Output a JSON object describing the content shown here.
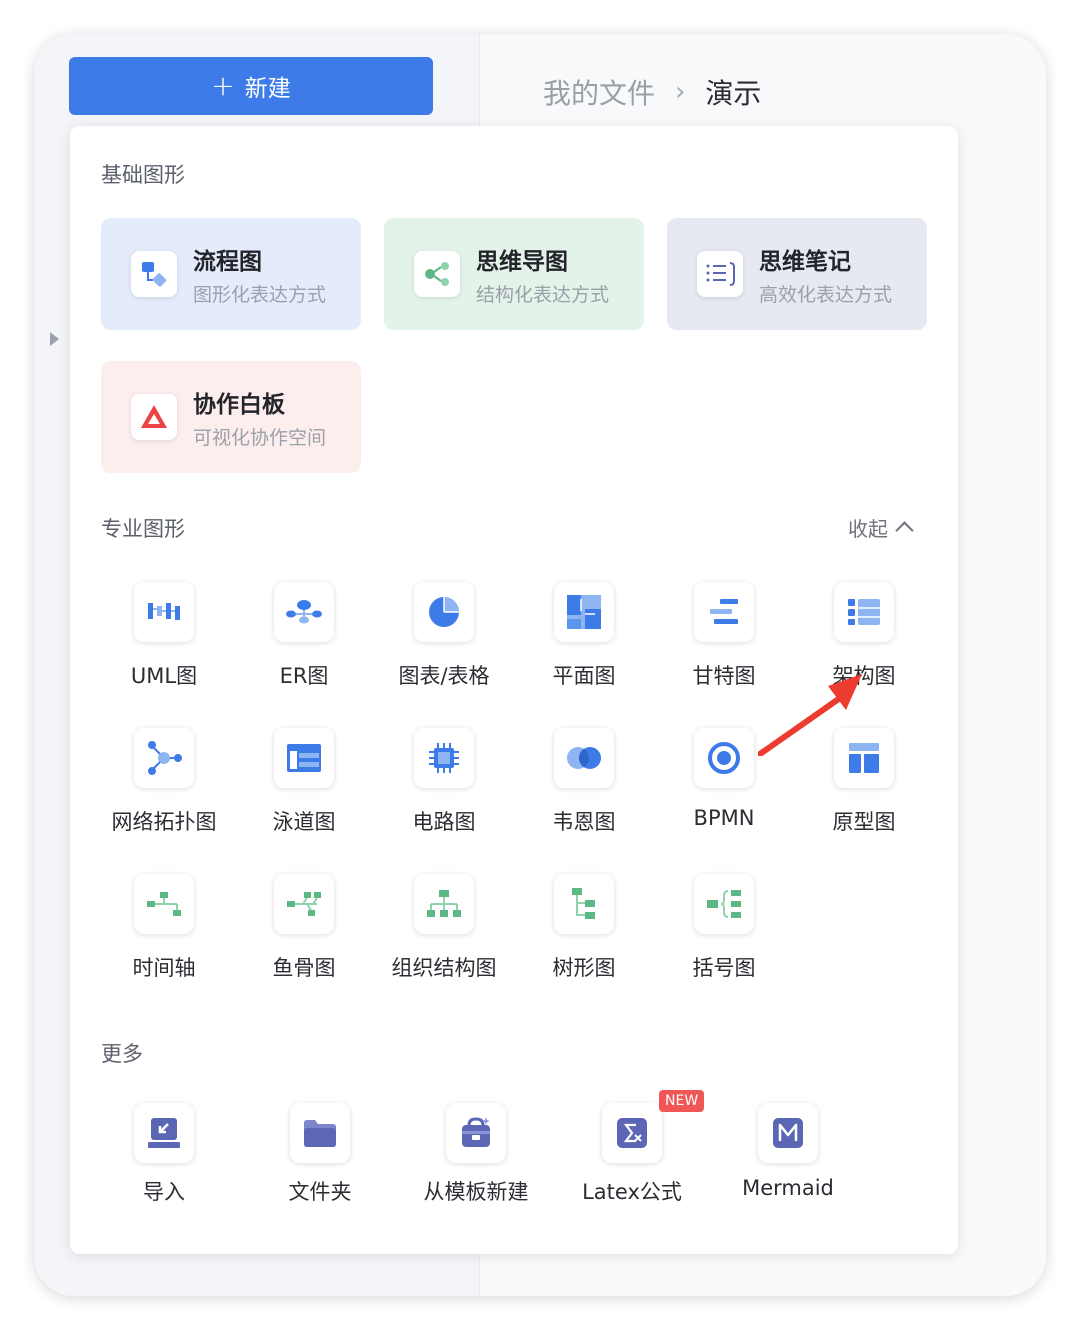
{
  "new_button": {
    "plus": "+",
    "label": "新建"
  },
  "breadcrumb": {
    "parent": "我的文件",
    "separator": "›",
    "current": "演示"
  },
  "basic": {
    "title": "基础图形",
    "cards": [
      {
        "title": "流程图",
        "subtitle": "图形化表达方式",
        "icon": "flowchart-icon",
        "bg": "#e4ecfc"
      },
      {
        "title": "思维导图",
        "subtitle": "结构化表达方式",
        "icon": "mindmap-icon",
        "bg": "#e3f3ea"
      },
      {
        "title": "思维笔记",
        "subtitle": "高效化表达方式",
        "icon": "notes-icon",
        "bg": "#e6e8f2"
      },
      {
        "title": "协作白板",
        "subtitle": "可视化协作空间",
        "icon": "whiteboard-icon",
        "bg": "#fdeeee"
      }
    ]
  },
  "pro": {
    "title": "专业图形",
    "collapse_label": "收起",
    "items": [
      {
        "label": "UML图",
        "icon": "uml-icon"
      },
      {
        "label": "ER图",
        "icon": "er-icon"
      },
      {
        "label": "图表/表格",
        "icon": "chart-table-icon"
      },
      {
        "label": "平面图",
        "icon": "floorplan-icon"
      },
      {
        "label": "甘特图",
        "icon": "gantt-icon"
      },
      {
        "label": "架构图",
        "icon": "architecture-icon"
      },
      {
        "label": "网络拓扑图",
        "icon": "network-topology-icon"
      },
      {
        "label": "泳道图",
        "icon": "swimlane-icon"
      },
      {
        "label": "电路图",
        "icon": "circuit-icon"
      },
      {
        "label": "韦恩图",
        "icon": "venn-icon"
      },
      {
        "label": "BPMN",
        "icon": "bpmn-icon"
      },
      {
        "label": "原型图",
        "icon": "prototype-icon"
      },
      {
        "label": "时间轴",
        "icon": "timeline-icon"
      },
      {
        "label": "鱼骨图",
        "icon": "fishbone-icon"
      },
      {
        "label": "组织结构图",
        "icon": "org-chart-icon"
      },
      {
        "label": "树形图",
        "icon": "tree-icon"
      },
      {
        "label": "括号图",
        "icon": "bracket-icon"
      }
    ]
  },
  "more": {
    "title": "更多",
    "items": [
      {
        "label": "导入",
        "icon": "import-icon"
      },
      {
        "label": "文件夹",
        "icon": "folder-icon"
      },
      {
        "label": "从模板新建",
        "icon": "template-icon"
      },
      {
        "label": "Latex公式",
        "icon": "latex-icon",
        "badge": "NEW"
      },
      {
        "label": "Mermaid",
        "icon": "mermaid-icon"
      }
    ]
  },
  "colors": {
    "accent": "#3d7ce8",
    "green": "#5cb885",
    "purple": "#5b67b5",
    "red": "#ec4444"
  }
}
